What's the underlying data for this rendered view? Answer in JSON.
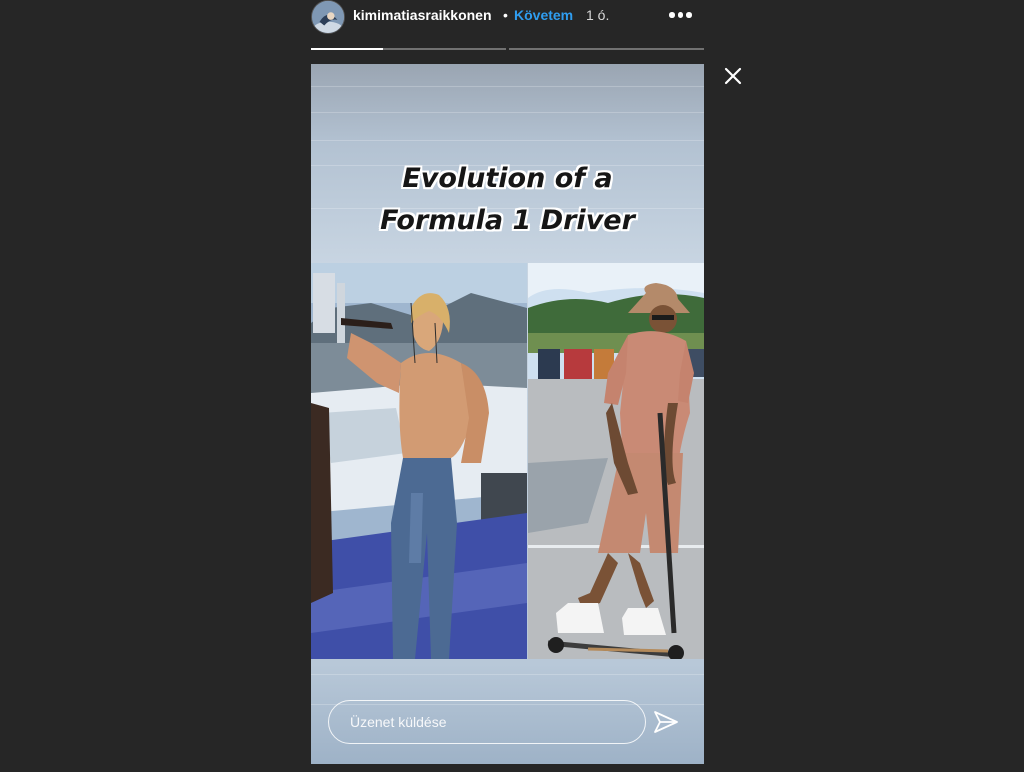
{
  "header": {
    "username": "kimimatiasraikkonen",
    "separator": "•",
    "follow_label": "Követem",
    "time_ago": "1 ó.",
    "avatar_icon": "profile-avatar",
    "more_icon": "more-options-icon"
  },
  "progress": {
    "segments_total": 2,
    "current_segment_progress": 0.37
  },
  "close_icon": "close-icon",
  "story": {
    "caption_line1": "Evolution of a",
    "caption_line2": "Formula 1 Driver",
    "images": [
      "driver-1970s-photo",
      "driver-modern-photo"
    ]
  },
  "reply": {
    "placeholder": "Üzenet küldése",
    "send_icon": "send-icon"
  },
  "colors": {
    "background": "#262626",
    "follow": "#2f9df0",
    "text": "#ffffff"
  }
}
